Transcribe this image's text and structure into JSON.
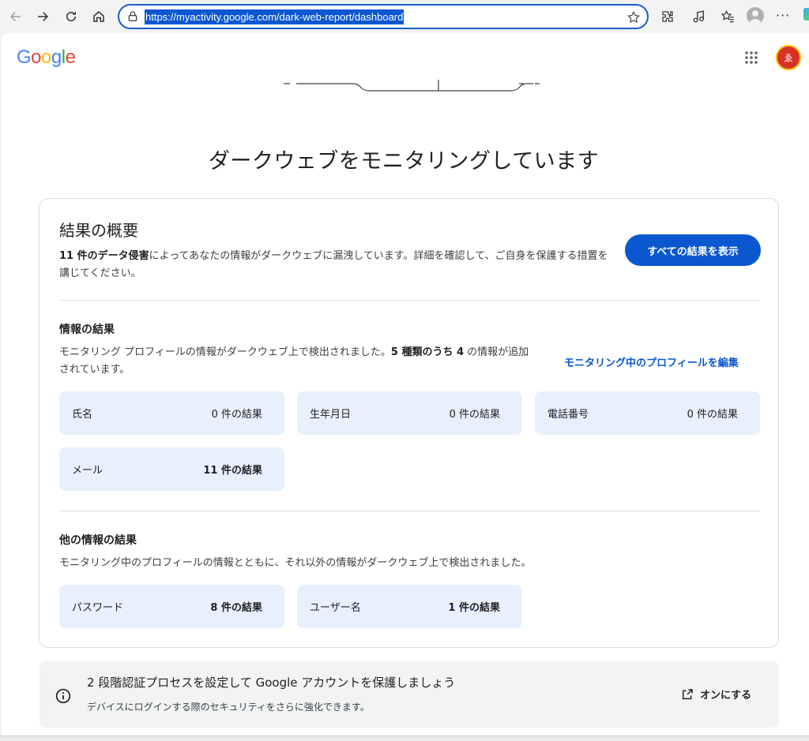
{
  "browser": {
    "url": "https://myactivity.google.com/dark-web-report/dashboard"
  },
  "header": {
    "logo_text": "Google",
    "avatar_initial": "ゑ"
  },
  "page_title": "ダークウェブをモニタリングしています",
  "summary": {
    "title": "結果の概要",
    "desc_bold": "11 件のデータ侵害",
    "desc_text": "によってあなたの情報がダークウェブに漏洩しています。詳細を確認して、ご自身を保護する措置を講じてください。",
    "view_all_label": "すべての結果を表示"
  },
  "info_results": {
    "title": "情報の結果",
    "desc_pre": "モニタリング プロフィールの情報がダークウェブ上で検出されました。",
    "desc_bold": "5 種類のうち 4",
    "desc_post": " の情報が追加されています。",
    "edit_link": "モニタリング中のプロフィールを編集",
    "tiles": [
      {
        "label": "氏名",
        "count": "0 件の結果"
      },
      {
        "label": "生年月日",
        "count": "0 件の結果"
      },
      {
        "label": "電話番号",
        "count": "0 件の結果"
      },
      {
        "label": "メール",
        "count": "11 件の結果"
      }
    ]
  },
  "other_results": {
    "title": "他の情報の結果",
    "desc": "モニタリング中のプロフィールの情報とともに、それ以外の情報がダークウェブ上で検出されました。",
    "tiles": [
      {
        "label": "パスワード",
        "count": "8 件の結果"
      },
      {
        "label": "ユーザー名",
        "count": "1 件の結果"
      }
    ]
  },
  "tip": {
    "title": "2 段階認証プロセスを設定して Google アカウントを保護しましょう",
    "desc": "デバイスにログインする際のセキュリティをさらに強化できます。",
    "action_label": "オンにする"
  },
  "colors": {
    "accent": "#0b57d0",
    "tile_bg": "#e8f0fe"
  }
}
